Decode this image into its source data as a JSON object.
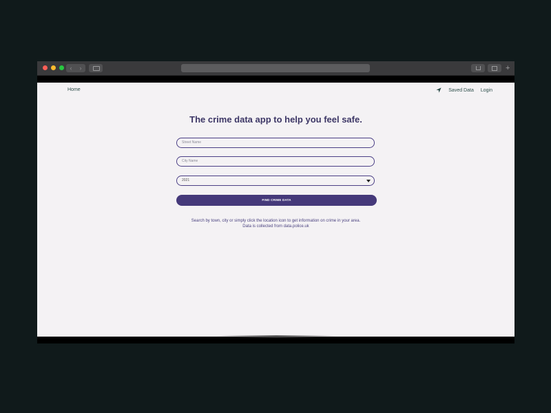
{
  "page": {
    "nav": {
      "home": "Home",
      "saved": "Saved Data",
      "login": "Login"
    },
    "heading": "The crime data app to help you feel safe.",
    "form": {
      "street_placeholder": "Street Name",
      "city_placeholder": "City Name",
      "year_value": "2021",
      "submit": "FIND CRIME DATA"
    },
    "help_line1": "Search by town, city or simply click the location icon to get information on crime in your area.",
    "help_line2": "Data is collected from data.police.uk"
  },
  "colors": {
    "accent": "#45397a",
    "nav_text": "#2e4f4b",
    "page_bg": "#f4f2f4"
  }
}
